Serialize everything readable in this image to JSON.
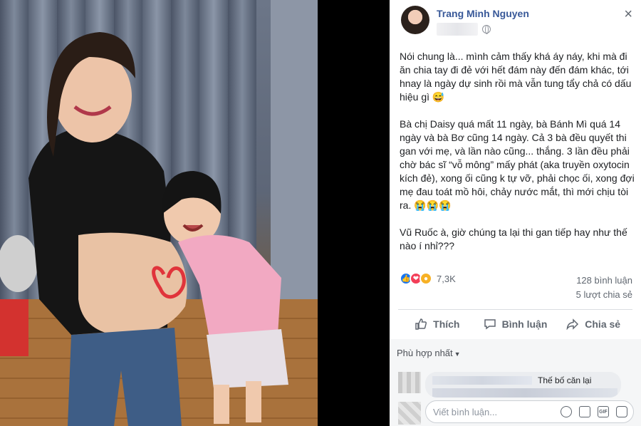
{
  "post": {
    "author": "Trang Minh Nguyen",
    "close_glyph": "×",
    "paragraphs": [
      "Nói chung là... mình cảm thấy khá áy náy, khi mà đi ăn chia tay đi đẻ với hết đám này đến đám khác, tới hnay là ngày dự sinh rồi mà vẫn tung tẩy chả có dấu hiệu gì 😅",
      "Bà chị Daisy quá mất 11 ngày, bà Bánh Mì quá 14 ngày và bà Bơ cũng 14 ngày. Cả 3 bà đều quyết thi gan với mẹ, và lần nào cũng... thắng. 3 lần đều phải chờ bác sĩ “vỗ mông” mấy phát (aka truyền oxytocin kích đẻ), xong ối cũng k tự vỡ, phải chọc ối, xong đợi mẹ đau toát mồ hôi, chảy nước mắt, thì mới chịu tòi ra. 😭😭😭",
      "Vũ Ruốc à, giờ chúng ta lại thi gan tiếp hay như thế nào í nhỉ???"
    ],
    "reaction_count": "7,3K",
    "comment_count": "128 bình luận",
    "share_count": "5 lượt chia sẻ",
    "actions": {
      "like": "Thích",
      "comment": "Bình luận",
      "share": "Chia sẻ"
    }
  },
  "comments": {
    "sort_label": "Phù hợp nhất",
    "first_comment_text": "Thế bố căn lại",
    "input_placeholder": "Viết bình luận...",
    "gif_label": "GIF"
  },
  "colors": {
    "link": "#385898",
    "secondary_text": "#606770",
    "like": "#1877f2",
    "love": "#f33e58",
    "wow": "#f7b125"
  }
}
